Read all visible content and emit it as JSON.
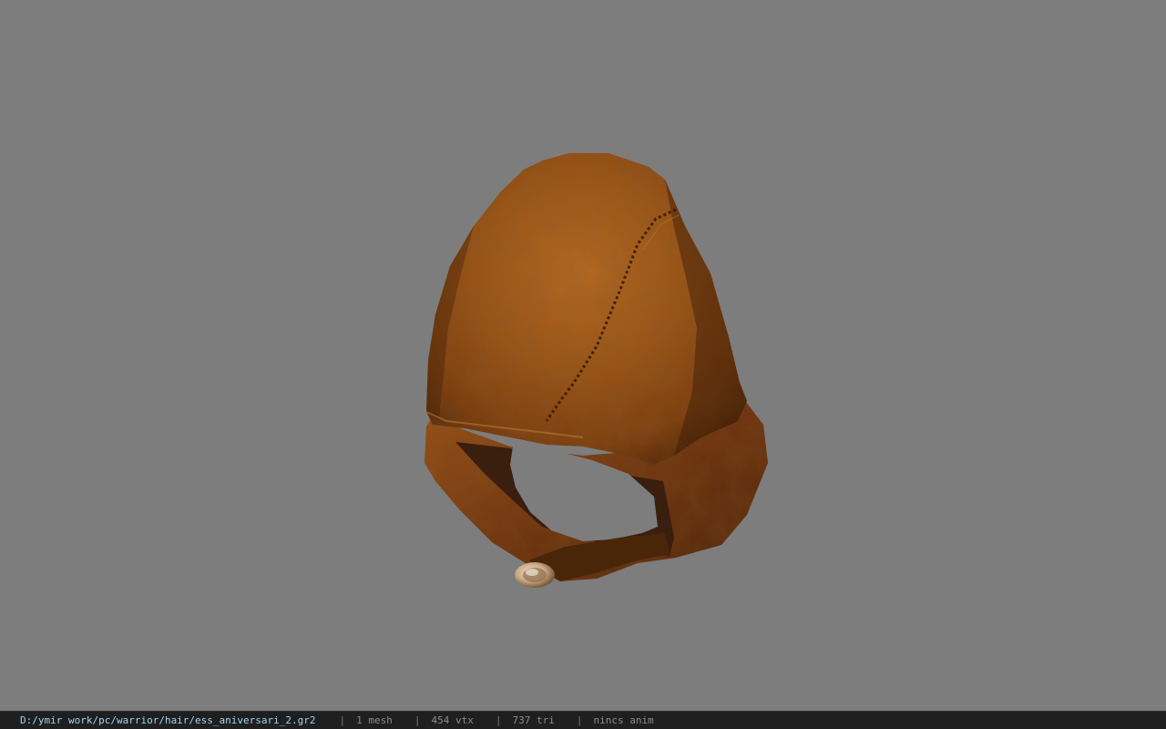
{
  "viewport": {
    "background": "#7d7d7d",
    "model": {
      "icon_name": "leather-hood-model",
      "colors": {
        "leather_base": "#8a4810",
        "leather_light": "#b86a22",
        "leather_dark": "#4a2208",
        "inner_lining": "#3a1e0e",
        "buckle": "#c9a882"
      }
    }
  },
  "status_bar": {
    "file_path": "D:/ymir work/pc/warrior/hair/ess_aniversari_2.gr2",
    "separator": "|",
    "mesh_count": "1 mesh",
    "vertex_count": "454 vtx",
    "triangle_count": "737 tri",
    "anim_status": "nincs anim",
    "path_color": "#9fd3f2",
    "text_color": "#8c8c8c"
  }
}
